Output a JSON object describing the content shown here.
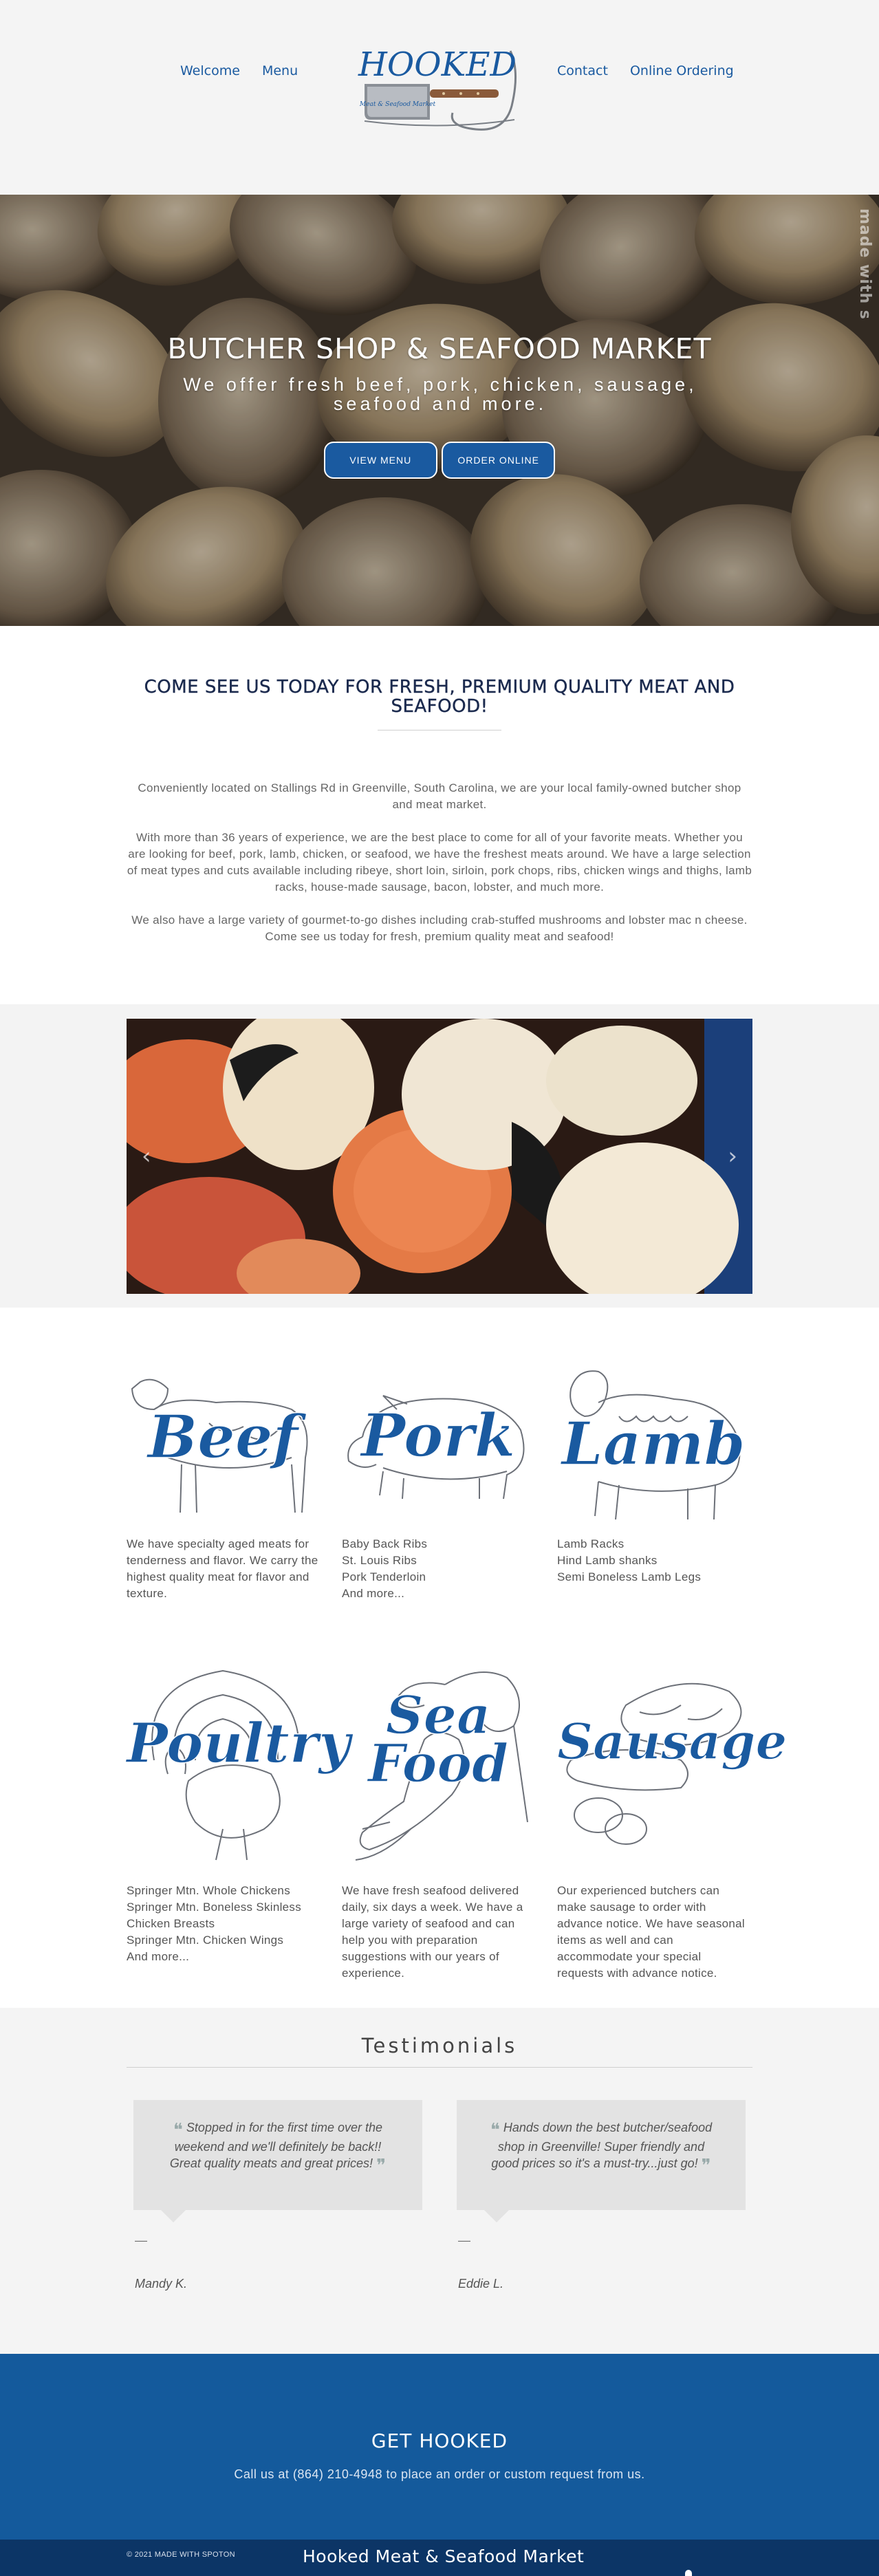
{
  "nav": {
    "left": [
      "Welcome",
      "Menu"
    ],
    "right": [
      "Contact",
      "Online Ordering"
    ]
  },
  "logo": {
    "wordmark": "HOOKED",
    "tagline": "Meat & Seafood Market"
  },
  "hero": {
    "title": "BUTCHER SHOP & SEAFOOD MARKET",
    "subtitle": "We offer fresh beef, pork, chicken, sausage, seafood and more.",
    "btn_menu": "VIEW MENU",
    "btn_order": "ORDER ONLINE",
    "badge": "made with s"
  },
  "intro": {
    "heading": "COME SEE US TODAY FOR FRESH, PREMIUM QUALITY MEAT AND SEAFOOD!",
    "p1": "Conveniently located on Stallings Rd in Greenville, South Carolina, we are your local family-owned butcher shop and meat market.",
    "p2": "With more than 36 years of experience, we are the best place to come for all of your favorite meats. Whether you are looking for beef, pork, lamb, chicken, or seafood, we have the freshest meats around. We have a large selection of meat types and cuts available including ribeye, short loin, sirloin, pork chops, ribs, chicken wings and thighs, lamb racks, house-made sausage, bacon, lobster, and much more.",
    "p3": "We also have a large variety of gourmet-to-go dishes including crab-stuffed mushrooms and lobster mac n cheese. Come see us today for fresh, premium quality meat and seafood!"
  },
  "slider": {
    "prev": "‹",
    "next": "›"
  },
  "categories": {
    "beef": {
      "word": "Beef",
      "desc": "We have specialty aged meats for tenderness and flavor. We carry the highest quality meat for flavor and texture."
    },
    "pork": {
      "word": "Pork",
      "lines": [
        "Baby Back Ribs",
        "St. Louis Ribs",
        "Pork Tenderloin",
        "And more..."
      ]
    },
    "lamb": {
      "word": "Lamb",
      "lines": [
        "Lamb Racks",
        "Hind Lamb shanks",
        "Semi Boneless Lamb Legs"
      ]
    },
    "poultry": {
      "word": "Poultry",
      "lines": [
        "Springer Mtn. Whole Chickens",
        "Springer Mtn. Boneless Skinless Chicken Breasts",
        "Springer Mtn. Chicken Wings",
        "And more..."
      ]
    },
    "seafood": {
      "word1": "Sea",
      "word2": "Food",
      "desc": "We have fresh seafood delivered daily, six days a week. We have a large variety of seafood and can help you with preparation suggestions with our years of experience."
    },
    "sausage": {
      "word": "Sausage",
      "desc": "Our experienced butchers can make sausage to order with advance notice. We have seasonal items as well and can accommodate your special requests with advance notice."
    }
  },
  "testimonials": {
    "heading": "Testimonials",
    "items": [
      {
        "quote": "Stopped in for the first time over the weekend and we'll definitely be back!! Great quality meats and great prices!",
        "dash": "—",
        "author": "Mandy K."
      },
      {
        "quote": "Hands down the best butcher/seafood shop in Greenville! Super friendly and good prices so it's a must-try...just go!",
        "dash": "—",
        "author": "Eddie L."
      }
    ]
  },
  "cta": {
    "heading": "GET HOOKED",
    "text": "Call us at (864) 210-4948 to place an order or custom request from us."
  },
  "footer": {
    "copyright": "© 2021 MADE WITH SPOTON",
    "name": "Hooked Meat & Seafood Market"
  },
  "colors": {
    "brand_blue": "#1a5aa0",
    "cta_blue": "#145a9c",
    "footer_navy": "#0c3566",
    "light_gray": "#f4f4f4"
  }
}
